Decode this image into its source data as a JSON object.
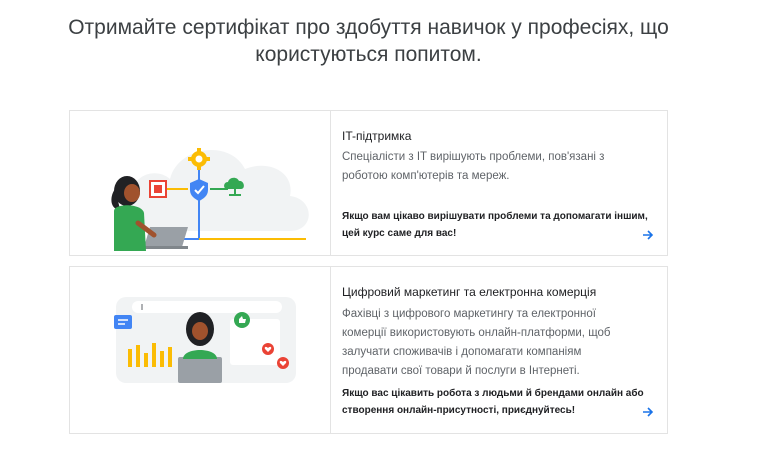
{
  "headline": "Отримайте сертифікат про здобуття навичок у професіях, що користуються попитом.",
  "cards": [
    {
      "title": "IT-підтримка",
      "description": "Спеціалісти з IT вирішують проблеми, пов'язані з роботою комп'ютерів та мереж.",
      "cta": "Якщо вам цікаво вирішувати проблеми та допомагати іншим, цей курс саме для вас!",
      "arrow_icon": "arrow-right-icon"
    },
    {
      "title": "Цифровий маркетинг та електронна комерція",
      "description": "Фахівці з цифрового маркетингу та електронної комерції використовують онлайн-платформи, щоб залучати споживачів і допомагати компаніям продавати свої товари й послуги в Інтернеті.",
      "cta": "Якщо вас цікавить робота з людьми й брендами онлайн або створення онлайн-присутності, приєднуйтесь!",
      "arrow_icon": "arrow-right-icon"
    }
  ],
  "colors": {
    "blue": "#4285f4",
    "green": "#34a853",
    "yellow": "#fbbc04",
    "red": "#ea4335",
    "cloud": "#f1f3f4",
    "skin": "#a0522d",
    "hair": "#202124"
  }
}
